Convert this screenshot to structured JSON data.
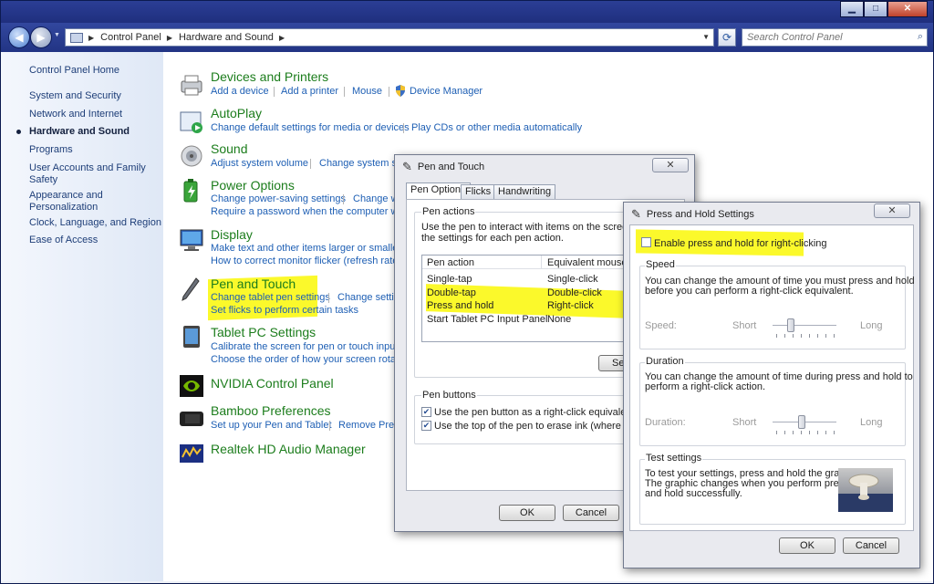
{
  "window": {
    "caption_buttons": {
      "minimize": "▁",
      "maximize": "□",
      "close": "✕"
    }
  },
  "address_bar": {
    "breadcrumbs": [
      "Control Panel",
      "Hardware and Sound"
    ],
    "search_placeholder": "Search Control Panel"
  },
  "sidebar": {
    "items": [
      {
        "label": "Control Panel Home"
      },
      {
        "label": "System and Security"
      },
      {
        "label": "Network and Internet"
      },
      {
        "label": "Hardware and Sound",
        "active": true
      },
      {
        "label": "Programs"
      },
      {
        "label": "User Accounts and Family Safety"
      },
      {
        "label": "Appearance and Personalization"
      },
      {
        "label": "Clock, Language, and Region"
      },
      {
        "label": "Ease of Access"
      }
    ]
  },
  "categories": {
    "devices": {
      "title": "Devices and Printers",
      "links": [
        "Add a device",
        "Add a printer",
        "Mouse",
        "Device Manager"
      ]
    },
    "autoplay": {
      "title": "AutoPlay",
      "links": [
        "Change default settings for media or devices",
        "Play CDs or other media automatically"
      ]
    },
    "sound": {
      "title": "Sound",
      "links": [
        "Adjust system volume",
        "Change system so"
      ]
    },
    "power": {
      "title": "Power Options",
      "links": [
        "Change power-saving settings",
        "Change w",
        "Require a password when the computer wake"
      ]
    },
    "display": {
      "title": "Display",
      "links": [
        "Make text and other items larger or smaller",
        "How to correct monitor flicker (refresh rate)"
      ]
    },
    "pen": {
      "title": "Pen and Touch",
      "links": [
        "Change tablet pen settings",
        "Change setti",
        "Set flicks to perform certain tasks"
      ]
    },
    "tablet": {
      "title": "Tablet PC Settings",
      "links": [
        "Calibrate the screen for pen or touch input",
        "Choose the order of how your screen rotates"
      ]
    },
    "nvidia": {
      "title": "NVIDIA Control Panel"
    },
    "bamboo": {
      "title": "Bamboo Preferences",
      "links": [
        "Set up your Pen and Tablet",
        "Remove Prefe"
      ]
    },
    "realtek": {
      "title": "Realtek HD Audio Manager"
    }
  },
  "pen_dialog": {
    "title": "Pen and Touch",
    "close": "✕",
    "tabs": [
      "Pen Options",
      "Flicks",
      "Handwriting"
    ],
    "pen_actions_title": "Pen actions",
    "pen_actions_desc1": "Use the pen to interact with items on the screen.",
    "pen_actions_desc2": "the settings for each pen action.",
    "table": {
      "headers": [
        "Pen action",
        "Equivalent mouse ac"
      ],
      "rows": [
        [
          "Single-tap",
          "Single-click"
        ],
        [
          "Double-tap",
          "Double-click"
        ],
        [
          "Press and hold",
          "Right-click"
        ],
        [
          "Start Tablet PC Input Panel",
          "None"
        ]
      ]
    },
    "settings_button": "Set",
    "pen_buttons_title": "Pen buttons",
    "checkbox1": "Use the pen button as a right-click equivalent",
    "checkbox2": "Use the top of the pen to erase ink (where availabl",
    "ok": "OK",
    "cancel": "Cancel"
  },
  "press_hold_dialog": {
    "title": "Press and Hold Settings",
    "close": "✕",
    "enable_label": "Enable press and hold for right-clicking",
    "speed_title": "Speed",
    "speed_desc1": "You can change the amount of time you must press and hold",
    "speed_desc2": "before you can perform a right-click equivalent.",
    "speed_label": "Speed:",
    "speed_short": "Short",
    "speed_long": "Long",
    "speed_level": 0.25,
    "duration_title": "Duration",
    "duration_desc1": "You can change the amount of time during press and hold to",
    "duration_desc2": "perform a right-click action.",
    "duration_label": "Duration:",
    "duration_short": "Short",
    "duration_long": "Long",
    "duration_level": 0.45,
    "test_title": "Test settings",
    "test_desc1": "To test your settings, press and hold the graphic.",
    "test_desc2": "The graphic changes when you perform press",
    "test_desc3": "and hold successfully.",
    "ok": "OK",
    "cancel": "Cancel"
  }
}
